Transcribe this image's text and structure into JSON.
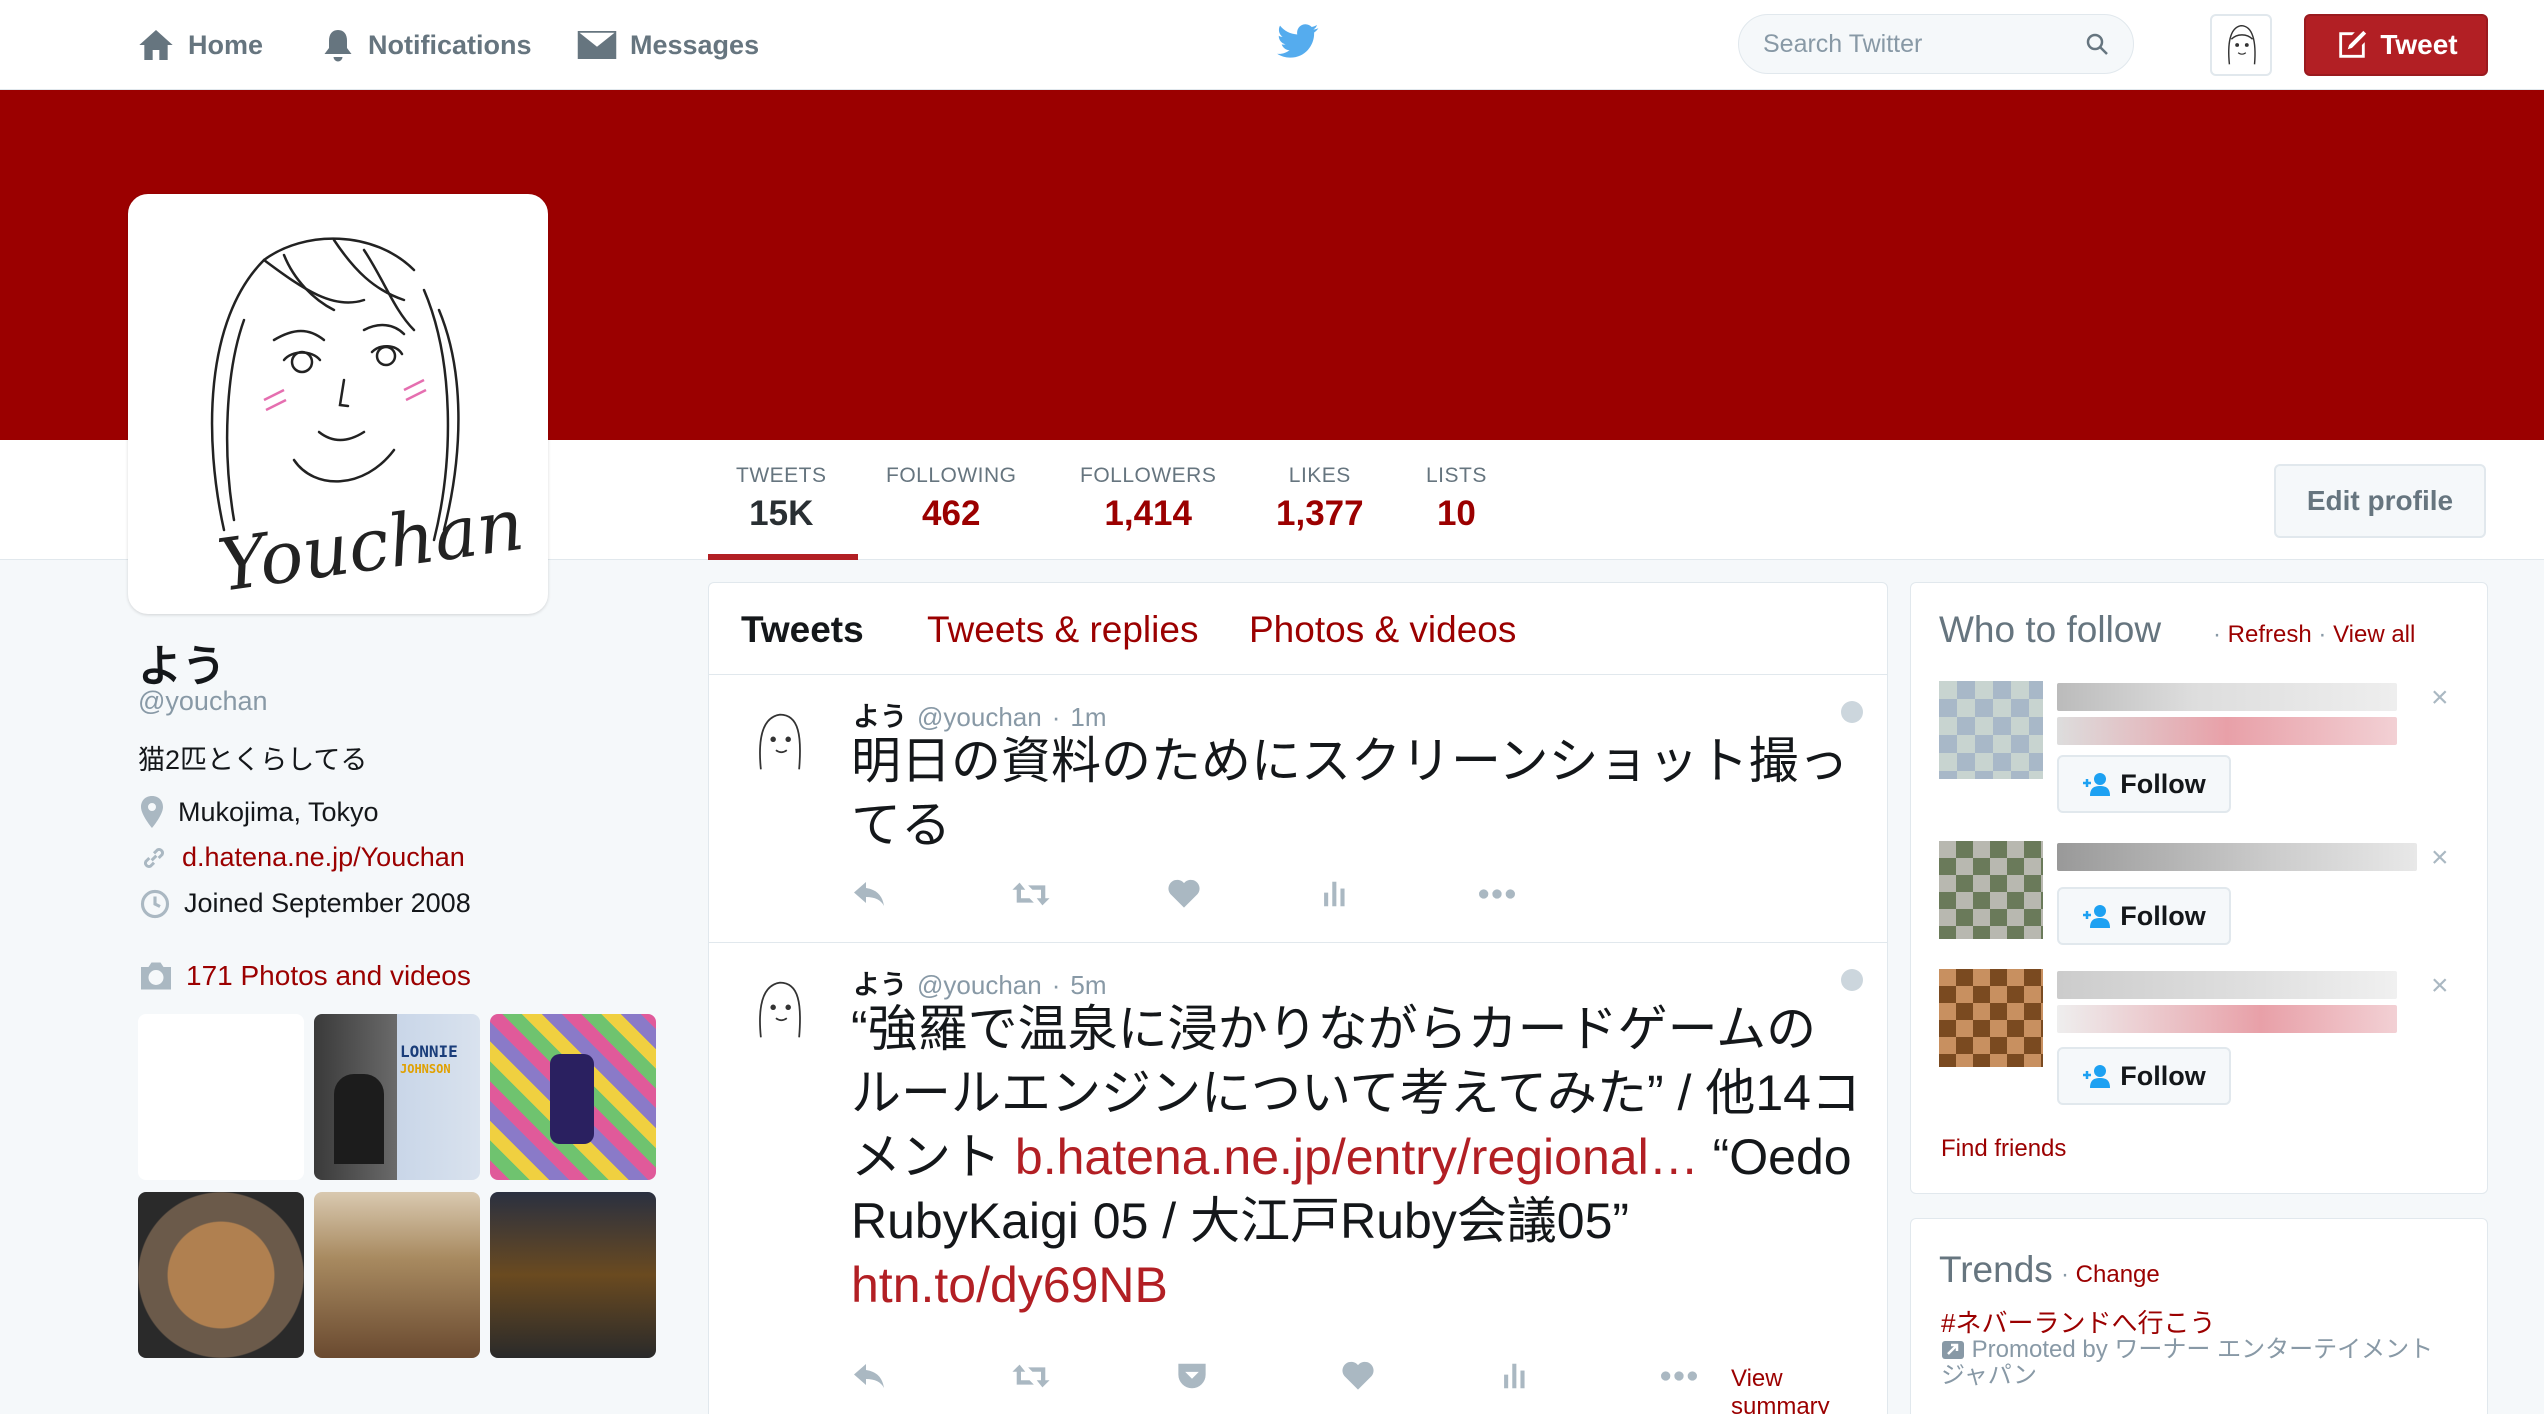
{
  "nav": {
    "home": "Home",
    "notifications": "Notifications",
    "messages": "Messages",
    "search_placeholder": "Search Twitter",
    "tweet_button": "Tweet"
  },
  "colors": {
    "theme": "#9b0000",
    "accent": "#b21f24"
  },
  "stats": [
    {
      "label": "TWEETS",
      "value": "15K"
    },
    {
      "label": "FOLLOWING",
      "value": "462"
    },
    {
      "label": "FOLLOWERS",
      "value": "1,414"
    },
    {
      "label": "LIKES",
      "value": "1,377"
    },
    {
      "label": "LISTS",
      "value": "10"
    }
  ],
  "edit_profile": "Edit profile",
  "profile": {
    "avatar_text": "Youchan",
    "name": "よう",
    "handle": "@youchan",
    "bio": "猫2匹とくらしてる",
    "location": "Mukojima, Tokyo",
    "url": "d.hatena.ne.jp/Youchan",
    "joined": "Joined September 2008",
    "photos_link": "171 Photos and videos",
    "album_title": "LONNIE",
    "album_subtitle": "JOHNSON"
  },
  "tabs": {
    "tweets": "Tweets",
    "replies": "Tweets & replies",
    "media": "Photos & videos"
  },
  "tweets": [
    {
      "name": "よう",
      "handle": "@youchan",
      "sep": "·",
      "time": "1m",
      "text": "明日の資料のためにスクリーンショット撮ってる"
    },
    {
      "name": "よう",
      "handle": "@youchan",
      "sep": "·",
      "time": "5m",
      "text_a": "“強羅で温泉に浸かりながらカードゲームのルールエンジンについて考えてみた” / 他14コメント ",
      "link_a": "b.hatena.ne.jp/entry/regional…",
      "text_b": " “Oedo RubyKaigi 05 / 大江戸Ruby会議05” ",
      "link_b": "htn.to/dy69NB",
      "view_summary": "View summary"
    }
  ],
  "who_to_follow": {
    "title": "Who to follow",
    "refresh": "Refresh",
    "view_all": "View all",
    "sep": "·",
    "follow_label": "Follow",
    "dismiss": "×",
    "find_friends": "Find friends"
  },
  "trends": {
    "title": "Trends",
    "sep": "·",
    "change": "Change",
    "item": "#ネバーランドへ行こう",
    "promoted": "Promoted by ワーナー エンターテイメント ジャパン"
  }
}
